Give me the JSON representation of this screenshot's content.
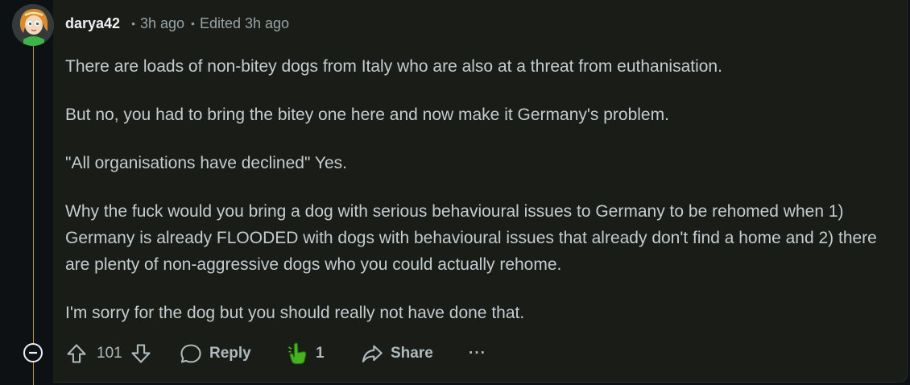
{
  "comment": {
    "username": "darya42",
    "separator": "•",
    "time_ago": "3h ago",
    "edited": "Edited 3h ago",
    "paragraphs": [
      "There are loads of non-bitey dogs from Italy who are also at a threat from euthanisation.",
      "But no, you had to bring the bitey one here and now make it Germany's problem.",
      "\"All organisations have declined\" Yes.",
      "Why the fuck would you bring a dog with serious behavioural issues to Germany to be rehomed when 1) Germany is already FLOODED with dogs with behavioural issues that already don't find a home and 2) there are plenty of non-aggressive dogs who you could actually rehome.",
      "I'm sorry for the dog but you should really not have done that."
    ]
  },
  "actions": {
    "vote_count": "101",
    "reply_label": "Reply",
    "award_count": "1",
    "share_label": "Share",
    "more_label": "···"
  },
  "colors": {
    "background": "#0e1113",
    "panel": "#1a1c17",
    "thread_line": "#b89a2a",
    "award_green": "#46b31f"
  },
  "icons": [
    "avatar",
    "collapse-icon",
    "upvote-icon",
    "downvote-icon",
    "reply-icon",
    "award-icon",
    "share-icon",
    "more-icon"
  ]
}
